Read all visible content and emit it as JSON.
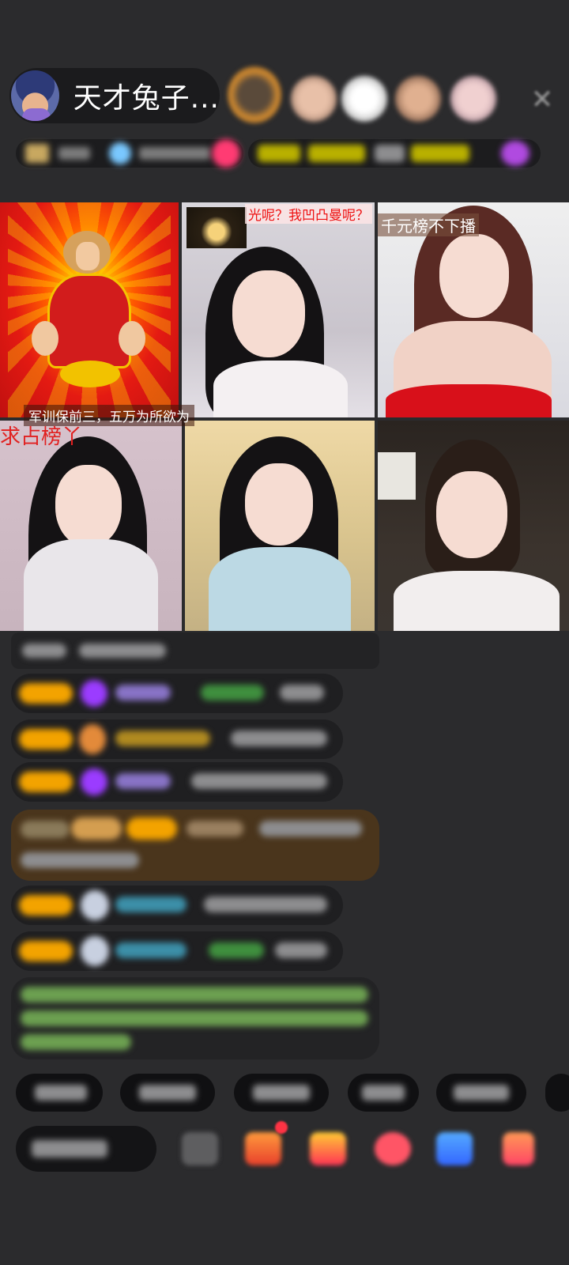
{
  "host": {
    "name": "天才兔子..."
  },
  "video_overlays": {
    "cell1_bottom": "军训保前三，五万为所欲为",
    "cell2_top": "光呢？我凹凸曼呢？",
    "cell3_top": "千元榜不下播",
    "cell4_top": "求占榜丫"
  },
  "colors": {
    "accent_gold": "#f3a300",
    "background": "#2b2b2d",
    "overlay_red": "#e12020"
  },
  "icons": [
    "host-avatar",
    "close-icon",
    "gift-icon",
    "emoji-icon",
    "share-icon"
  ]
}
